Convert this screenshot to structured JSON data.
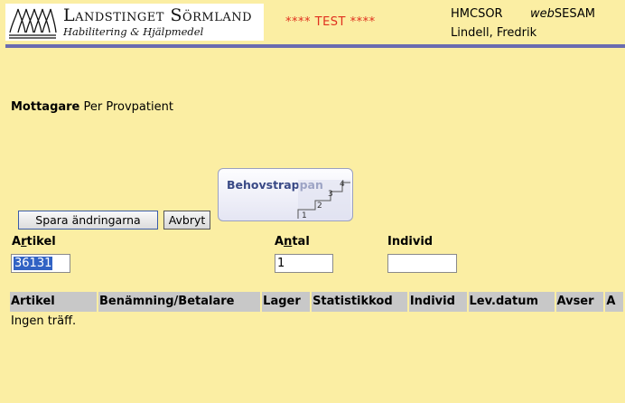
{
  "header": {
    "logo_title": "Landstinget Sörmland",
    "logo_subtitle": "Habilitering & Hjälpmedel",
    "test_banner": "**** TEST ****",
    "system_code": "HMCSOR",
    "app_name_prefix": "web",
    "app_name_suffix": "SESAM",
    "user_name": "Lindell, Fredrik"
  },
  "recipient": {
    "label": "Mottagare",
    "value": "Per Provpatient"
  },
  "behovstrappan": {
    "label": "Behovstrappan",
    "steps": [
      "1",
      "2",
      "3",
      "4"
    ]
  },
  "buttons": {
    "save": "Spara ändringarna",
    "cancel": "Avbryt"
  },
  "form": {
    "artikel_label_pre": "A",
    "artikel_label_key": "r",
    "artikel_label_post": "tikel",
    "artikel_value": "36131",
    "antal_label_pre": "A",
    "antal_label_key": "n",
    "antal_label_post": "tal",
    "antal_value": "1",
    "individ_label": "Individ",
    "individ_value": ""
  },
  "results": {
    "columns": [
      "Artikel",
      "Benämning/Betalare",
      "Lager",
      "Statistikkod",
      "Individ",
      "Lev.datum",
      "Avser",
      "A"
    ],
    "empty_message": "Ingen träff."
  },
  "colors": {
    "background": "#fbeea3",
    "rule": "#6a6bb0",
    "test_banner": "#e0301e",
    "table_header": "#c8c8c8",
    "selection": "#3162c4"
  }
}
